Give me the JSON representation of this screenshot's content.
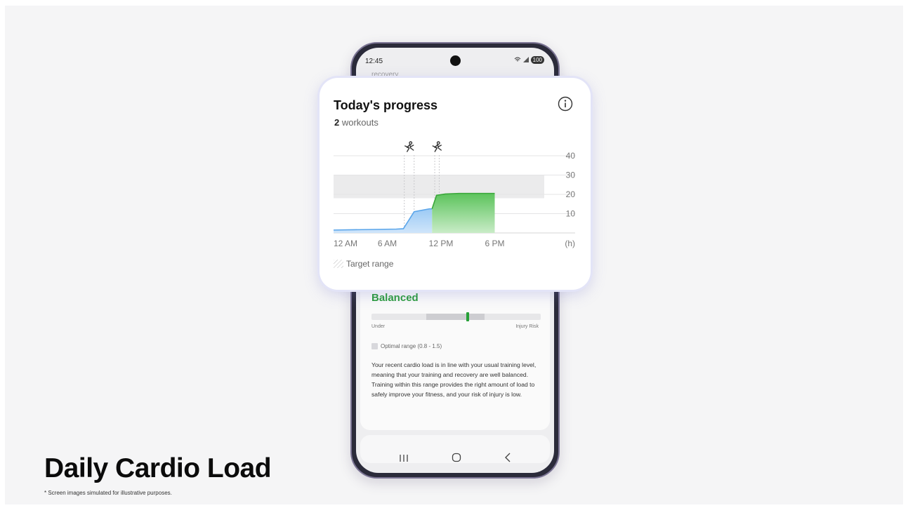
{
  "phone": {
    "status_time": "12:45",
    "status_icons": [
      "wifi-icon",
      "signal-icon"
    ],
    "battery": "100",
    "recovery_text": "recovery.",
    "balanced_label": "Balanced",
    "range_under_label": "Under",
    "range_injury_label": "Injury Risk",
    "optimal_range_label": "Optimal range (0.8 - 1.5)",
    "description": "Your recent cardio load is in line with your usual training level, meaning that your training and recovery are well balanced. Training within this range provides the right amount of load to safely improve your fitness, and your risk of injury is low.",
    "nav": [
      "recent-apps-icon",
      "home-icon",
      "back-icon"
    ]
  },
  "card": {
    "title": "Today's progress",
    "workout_count": "2",
    "workout_word": "workouts",
    "legend_label": "Target range"
  },
  "chart_data": {
    "type": "area",
    "x_ticks": [
      "12 AM",
      "6 AM",
      "12 PM",
      "6 PM",
      "(h)"
    ],
    "y_ticks": [
      "40",
      "30",
      "20",
      "10"
    ],
    "ylim": [
      0,
      40
    ],
    "xlim": [
      0,
      24
    ],
    "target_range": [
      18,
      30
    ],
    "workout_markers": [
      {
        "start": 7.9,
        "end": 9.0
      },
      {
        "start": 11.3,
        "end": 11.8
      }
    ],
    "series": [
      {
        "color": "#9cc8f2",
        "x": [
          0,
          7.0,
          7.8,
          9.0,
          10.7,
          11.0
        ],
        "y": [
          1.5,
          2.0,
          2.2,
          11.0,
          12.5,
          12.5
        ]
      },
      {
        "color": "#5bc15b",
        "x": [
          11.0,
          11.5,
          12.5,
          14.0,
          18.0
        ],
        "y": [
          12.5,
          19.5,
          20.2,
          20.5,
          20.5
        ]
      }
    ]
  },
  "headline": "Daily Cardio Load",
  "disclaimer": "* Screen images simulated for illustrative purposes."
}
